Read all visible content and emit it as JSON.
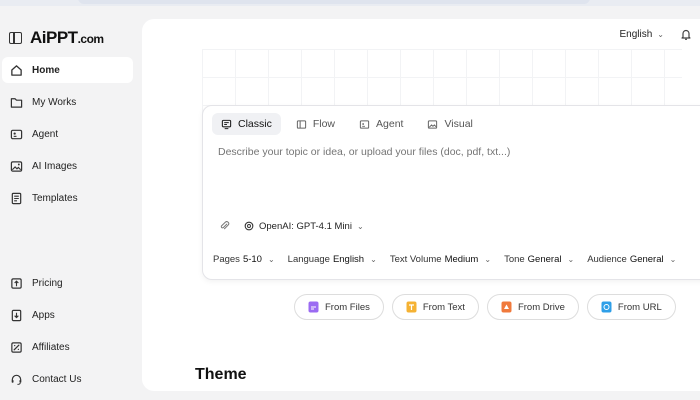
{
  "brand": {
    "logo_main": "AiPPT",
    "logo_suffix": ".com"
  },
  "sidebar": {
    "items": [
      {
        "label": "Home",
        "icon": "home-icon",
        "active": true
      },
      {
        "label": "My Works",
        "icon": "folder-icon"
      },
      {
        "label": "Agent",
        "icon": "agent-icon"
      },
      {
        "label": "AI Images",
        "icon": "image-icon"
      },
      {
        "label": "Templates",
        "icon": "template-icon"
      }
    ],
    "bottom_items": [
      {
        "label": "Pricing",
        "icon": "pricing-icon"
      },
      {
        "label": "Apps",
        "icon": "apps-icon"
      },
      {
        "label": "Affiliates",
        "icon": "affiliates-icon"
      },
      {
        "label": "Contact Us",
        "icon": "headset-icon"
      }
    ]
  },
  "header": {
    "language": "English"
  },
  "creator": {
    "tabs": [
      {
        "label": "Classic",
        "active": true
      },
      {
        "label": "Flow"
      },
      {
        "label": "Agent"
      },
      {
        "label": "Visual"
      }
    ],
    "placeholder": "Describe your topic or idea, or upload your files (doc, pdf, txt...)",
    "model": "OpenAI: GPT-4.1 Mini",
    "options": [
      {
        "label": "Pages",
        "value": "5-10"
      },
      {
        "label": "Language",
        "value": "English"
      },
      {
        "label": "Text Volume",
        "value": "Medium"
      },
      {
        "label": "Tone",
        "value": "General"
      },
      {
        "label": "Audience",
        "value": "General"
      }
    ]
  },
  "sources": [
    {
      "label": "From Files",
      "color": "#9b6bf2"
    },
    {
      "label": "From Text",
      "color": "#f5b233"
    },
    {
      "label": "From Drive",
      "color": "#f07a3c"
    },
    {
      "label": "From URL",
      "color": "#2f9fe8"
    }
  ],
  "section": {
    "theme_heading": "Theme"
  }
}
